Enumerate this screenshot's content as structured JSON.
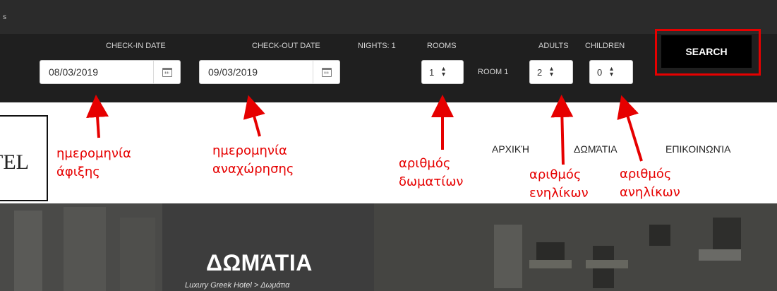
{
  "topbar": {
    "glyph": "s"
  },
  "booking": {
    "checkin_label": "CHECK-IN DATE",
    "checkout_label": "CHECK-OUT DATE",
    "nights_label": "NIGHTS: 1",
    "rooms_label": "ROOMS",
    "adults_label": "ADULTS",
    "children_label": "CHILDREN",
    "checkin_value": "08/03/2019",
    "checkout_value": "09/03/2019",
    "rooms_value": "1",
    "room_row_label": "ROOM 1",
    "adults_value": "2",
    "children_value": "0",
    "search_label": "SEARCH",
    "calendar_icon": "calendar-icon",
    "stepper_icon": "up-down-arrows-icon",
    "highlight_color": "#e60000"
  },
  "logo": {
    "text": "TEL"
  },
  "nav": {
    "items": [
      {
        "label": "ΑΡΧΙΚΉ"
      },
      {
        "label": "ΔΩΜΆΤΙΑ"
      },
      {
        "label": "ΕΠΙΚΟΙΝΩΝΊΑ"
      }
    ]
  },
  "annotations": {
    "color": "#e60000",
    "arrival_line1": "ημερομηνία",
    "arrival_line2": "άφιξης",
    "departure_line1": "ημερομηνία",
    "departure_line2": "αναχώρησης",
    "rooms_line1": "αριθμός",
    "rooms_line2": "δωματίων",
    "adults_line1": "αριθμός",
    "adults_line2": "ενηλίκων",
    "children_line1": "αριθμός",
    "children_line2": "ανηλίκων"
  },
  "hero": {
    "title": "ΔΩΜΆΤΙΑ",
    "breadcrumb": "Luxury Greek Hotel > Δωμάτια"
  }
}
